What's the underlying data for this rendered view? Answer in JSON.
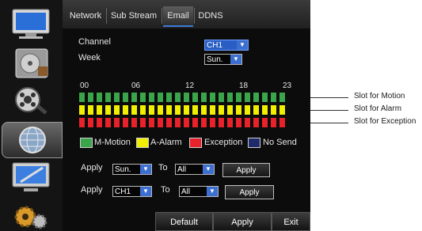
{
  "tabs": [
    {
      "label": "Network",
      "active": false
    },
    {
      "label": "Sub Stream",
      "active": false
    },
    {
      "label": "Email",
      "active": true
    },
    {
      "label": "DDNS",
      "active": false
    }
  ],
  "sidebar": {
    "items": [
      {
        "icon": "monitor-icon"
      },
      {
        "icon": "hard-disk-icon"
      },
      {
        "icon": "search-record-icon"
      },
      {
        "icon": "network-globe-icon",
        "active": true
      },
      {
        "icon": "system-settings-icon"
      },
      {
        "icon": "gears-icon"
      }
    ]
  },
  "form": {
    "channel_label": "Channel",
    "channel_value": "CH1",
    "week_label": "Week",
    "week_value": "Sun."
  },
  "schedule": {
    "hour_ticks": [
      "00",
      "06",
      "12",
      "18",
      "23"
    ],
    "rows": [
      {
        "type": "Motion",
        "color": "#3aa54a"
      },
      {
        "type": "Alarm",
        "color": "#f2ee00"
      },
      {
        "type": "Exception",
        "color": "#e8222a"
      }
    ]
  },
  "legend": {
    "items": [
      {
        "label": "M-Motion",
        "color": "#3aa54a"
      },
      {
        "label": "A-Alarm",
        "color": "#f2ee00"
      },
      {
        "label": "Exception",
        "color": "#e8222a"
      },
      {
        "label": "No Send",
        "color": "#1e2a6a"
      }
    ]
  },
  "apply_rows": [
    {
      "apply_label": "Apply",
      "from_value": "Sun.",
      "to_label": "To",
      "to_value": "All",
      "button_label": "Apply"
    },
    {
      "apply_label": "Apply",
      "from_value": "CH1",
      "to_label": "To",
      "to_value": "All",
      "button_label": "Apply"
    }
  ],
  "footer": {
    "default_label": "Default",
    "apply_label": "Apply",
    "exit_label": "Exit"
  },
  "callouts": {
    "motion": "Slot for Motion",
    "alarm": "Slot for Alarm",
    "exception": "Slot for Exception"
  }
}
